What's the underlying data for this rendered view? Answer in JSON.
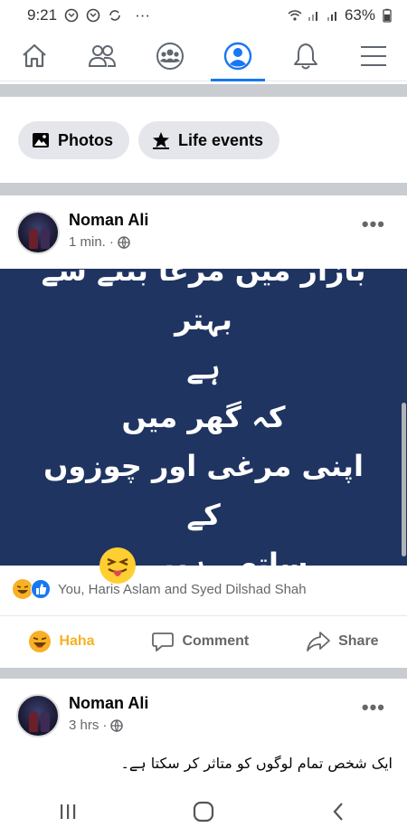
{
  "status": {
    "time": "9:21",
    "dots": "···",
    "battery": "63%"
  },
  "nav": {
    "items": [
      {
        "name": "home",
        "active": false
      },
      {
        "name": "friends",
        "active": false
      },
      {
        "name": "groups",
        "active": false
      },
      {
        "name": "profile",
        "active": true
      },
      {
        "name": "notifications",
        "active": false
      },
      {
        "name": "menu",
        "active": false
      }
    ]
  },
  "chips": {
    "photos": "Photos",
    "life_events": "Life events"
  },
  "posts": [
    {
      "author": "Noman Ali",
      "time": "1 min.",
      "image_lines": [
        "بازار میں مرغا بننے سے بہتر",
        "ہے",
        "کہ گھر میں",
        "اپنی مرغی اور چوزوں کے",
        "ساتھ رہیں"
      ],
      "reactions_text": "You, Haris Aslam and Syed Dilshad Shah",
      "actions": {
        "haha": "Haha",
        "comment": "Comment",
        "share": "Share"
      }
    },
    {
      "author": "Noman Ali",
      "time": "3 hrs",
      "text": "ایک شخص تمام لوگوں کو متاثر کر سکتا ہے۔"
    }
  ],
  "colors": {
    "accent": "#1877f2",
    "image_bg": "#1f3461",
    "haha": "#f7b125"
  }
}
